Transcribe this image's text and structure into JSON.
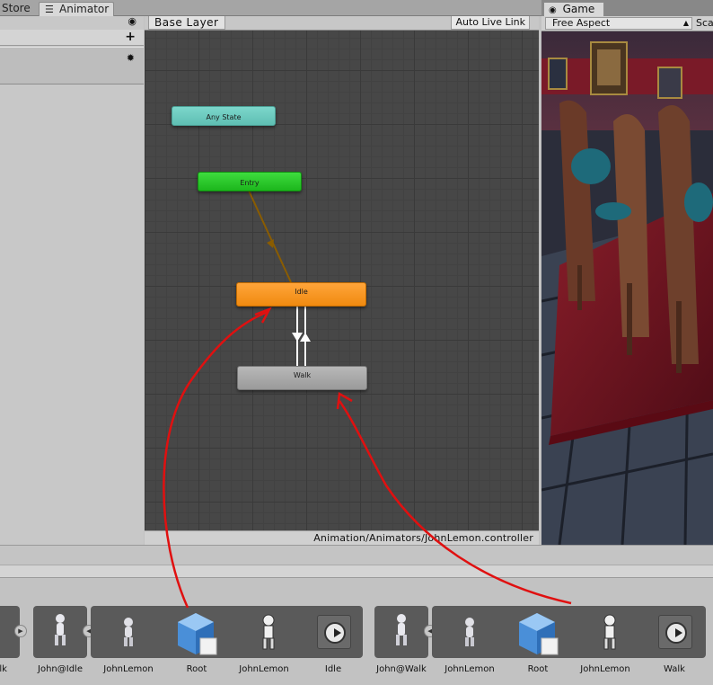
{
  "tabs": {
    "store": "Store",
    "animator": "Animator",
    "game": "Game"
  },
  "animator": {
    "layer": "Base Layer",
    "auto_live_link": "Auto Live Link",
    "controller_path": "Animation/Animators/JohnLemon.controller",
    "states": {
      "any": "Any State",
      "entry": "Entry",
      "idle": "Idle",
      "walk": "Walk"
    },
    "colors": {
      "any": "#6ccabe",
      "entry": "#22c022",
      "idle": "#f59a22",
      "walk": "#a8a8a8"
    }
  },
  "game": {
    "aspect": "Free Aspect",
    "scale_label": "Sca"
  },
  "assets": {
    "walk_cut": "Walk",
    "idle_model": "John@Idle",
    "idle_mesh": "JohnLemon",
    "idle_root": "Root",
    "idle_avatar": "JohnLemon",
    "idle_clip": "Idle",
    "walk_model": "John@Walk",
    "walk_mesh": "JohnLemon",
    "walk_root": "Root",
    "walk_avatar": "JohnLemon",
    "walk_clip": "Walk"
  },
  "annotation_color": "#e01010"
}
